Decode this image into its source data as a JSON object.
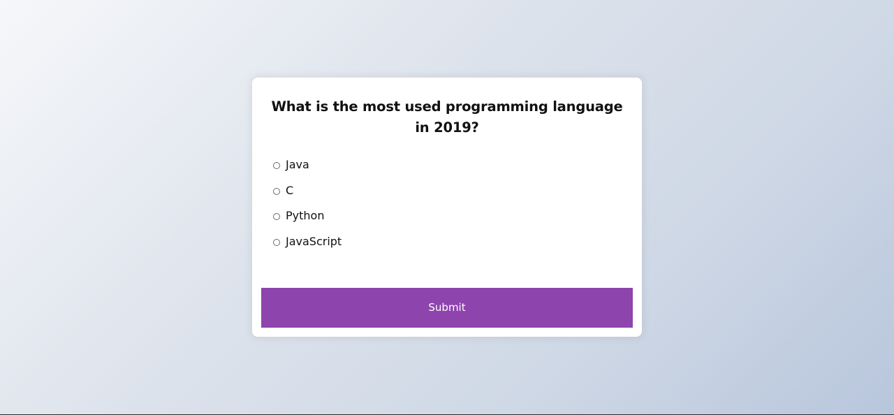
{
  "quiz": {
    "question": "What is the most used programming language in 2019?",
    "answers": [
      {
        "label": "Java",
        "selected": false
      },
      {
        "label": "C",
        "selected": false
      },
      {
        "label": "Python",
        "selected": false
      },
      {
        "label": "JavaScript",
        "selected": false
      }
    ],
    "submit_label": "Submit"
  },
  "colors": {
    "accent": "#8e44ad",
    "card": "#ffffff",
    "text": "#111111"
  }
}
